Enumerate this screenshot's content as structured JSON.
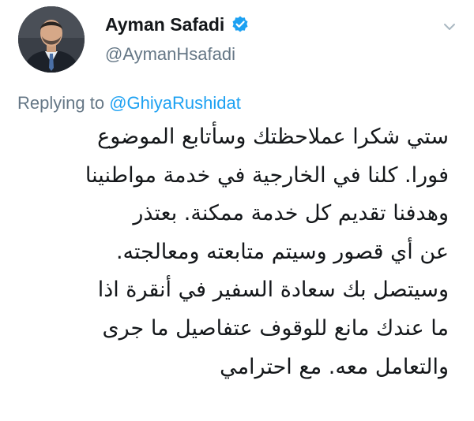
{
  "author": {
    "display_name": "Ayman Safadi",
    "handle": "@AymanHsafadi",
    "verified": true,
    "avatar_icon": "profile-photo-icon"
  },
  "reply": {
    "prefix": "Replying to ",
    "mention": "@GhiyaRushidat"
  },
  "tweet": {
    "lines": [
      "ستي شكرا عملاحظتك وسأتابع الموضوع",
      "فورا. كلنا في الخارجية في خدمة مواطنينا",
      "وهدفنا تقديم كل خدمة ممكنة. بعتذر",
      "عن أي قصور وسيتم متابعته ومعالجته.",
      "وسيتصل بك سعادة السفير في أنقرة اذا",
      "ما عندك مانع للوقوف عتفاصيل ما جرى",
      "والتعامل معه. مع احترامي"
    ]
  },
  "colors": {
    "verified_badge": "#1da1f2",
    "link": "#1da1f2",
    "secondary_text": "#657786"
  }
}
